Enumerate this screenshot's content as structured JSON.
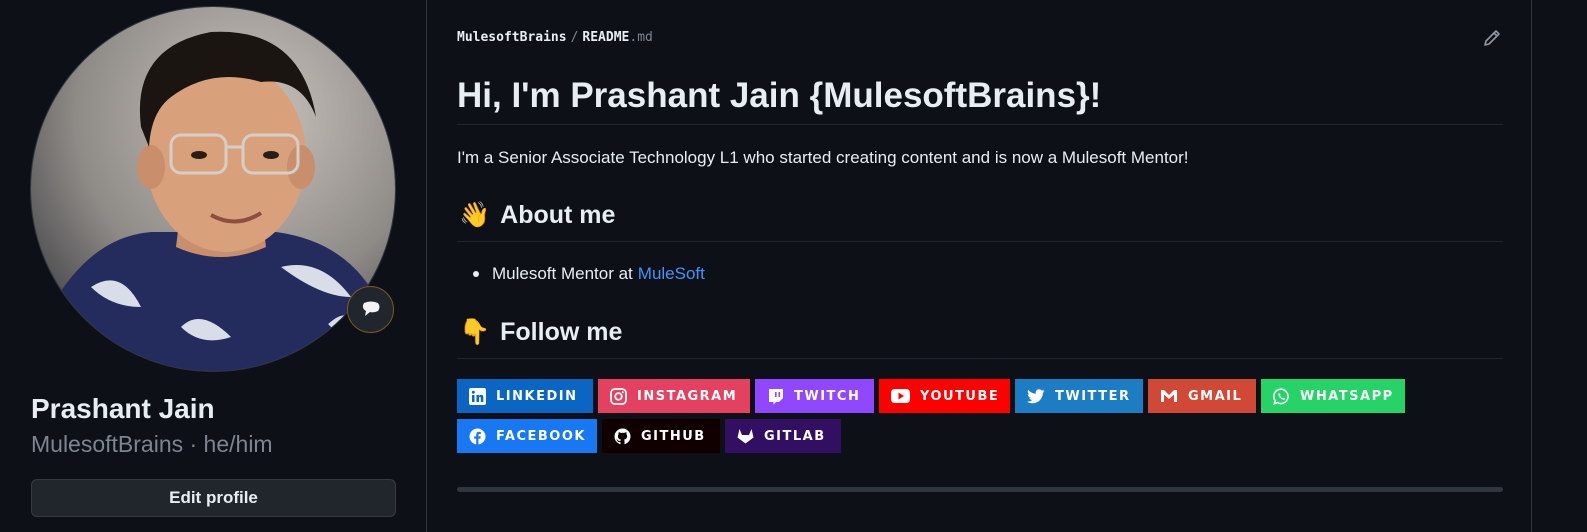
{
  "profile": {
    "name": "Prashant Jain",
    "subtitle": "MulesoftBrains · he/him",
    "edit_label": "Edit profile"
  },
  "readme": {
    "owner": "MulesoftBrains",
    "separator": "/",
    "file_name": "README",
    "file_ext": ".md",
    "title": "Hi, I'm Prashant Jain {MulesoftBrains}!",
    "intro": "I'm a Senior Associate Technology L1 who started creating content and is now a Mulesoft Mentor!",
    "about_emoji": "👋",
    "about_heading": "About me",
    "about_item_prefix": "Mulesoft Mentor at",
    "about_item_link": "MuleSoft",
    "follow_emoji": "👇",
    "follow_heading": "Follow me"
  },
  "badges": [
    {
      "label": "LINKEDIN",
      "color": "#0a66c2",
      "icon": "linkedin-icon"
    },
    {
      "label": "INSTAGRAM",
      "color": "#e4405f",
      "icon": "instagram-icon"
    },
    {
      "label": "TWITCH",
      "color": "#9146ff",
      "icon": "twitch-icon"
    },
    {
      "label": "YOUTUBE",
      "color": "#ff0000",
      "icon": "youtube-icon"
    },
    {
      "label": "TWITTER",
      "color": "#1d7dc4",
      "icon": "twitter-icon"
    },
    {
      "label": "GMAIL",
      "color": "#d14836",
      "icon": "gmail-icon"
    },
    {
      "label": "WHATSAPP",
      "color": "#25d366",
      "icon": "whatsapp-icon"
    },
    {
      "label": "FACEBOOK",
      "color": "#1877f2",
      "icon": "facebook-icon"
    },
    {
      "label": "GITHUB",
      "color": "#100000",
      "icon": "github-icon"
    },
    {
      "label": "GITLAB",
      "color": "#330f63",
      "icon": "gitlab-icon"
    }
  ]
}
